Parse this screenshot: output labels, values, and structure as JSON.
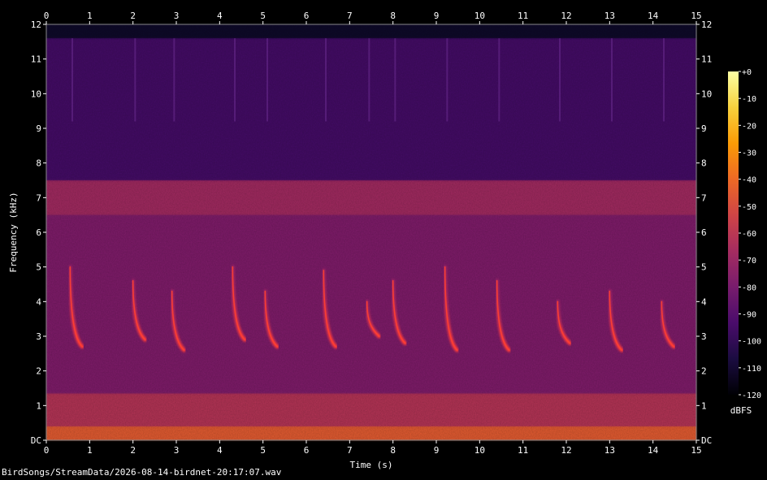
{
  "chart_data": {
    "type": "heatmap",
    "title": "",
    "xlabel": "Time (s)",
    "ylabel": "Frequency (kHz)",
    "xlim": [
      0,
      15
    ],
    "ylim": [
      0,
      12
    ],
    "x_ticks": [
      "0",
      "1",
      "2",
      "3",
      "4",
      "5",
      "6",
      "7",
      "8",
      "9",
      "10",
      "11",
      "12",
      "13",
      "14",
      "15"
    ],
    "y_ticks": [
      "DC",
      "1",
      "2",
      "3",
      "4",
      "5",
      "6",
      "7",
      "8",
      "9",
      "10",
      "11",
      "12"
    ],
    "colorbar": {
      "label": "dBFS",
      "range": [
        -120,
        0
      ],
      "ticks": [
        "+0",
        "-10",
        "-20",
        "-30",
        "-40",
        "-50",
        "-60",
        "-70",
        "-80",
        "-90",
        "-100",
        "-110",
        "-120"
      ],
      "colors": [
        "#000004",
        "#1b0c41",
        "#4a0c6b",
        "#781c6d",
        "#a52c60",
        "#cf4446",
        "#ed6925",
        "#fb9b06",
        "#f7d13d",
        "#fcffa4"
      ]
    },
    "noise_bands": [
      {
        "f_low": 0.0,
        "f_high": 0.4,
        "level_db": -45
      },
      {
        "f_low": 0.4,
        "f_high": 1.35,
        "level_db": -62
      },
      {
        "f_low": 1.35,
        "f_high": 6.5,
        "level_db": -78
      },
      {
        "f_low": 6.5,
        "f_high": 7.5,
        "level_db": -68
      },
      {
        "f_low": 7.5,
        "f_high": 11.6,
        "level_db": -95
      },
      {
        "f_low": 11.6,
        "f_high": 12.0,
        "level_db": -112
      }
    ],
    "calls": [
      {
        "t": 0.55,
        "f_start": 5.0,
        "f_end": 2.7
      },
      {
        "t": 2.0,
        "f_start": 4.6,
        "f_end": 2.9
      },
      {
        "t": 2.9,
        "f_start": 4.3,
        "f_end": 2.6
      },
      {
        "t": 4.3,
        "f_start": 5.0,
        "f_end": 2.9
      },
      {
        "t": 5.05,
        "f_start": 4.3,
        "f_end": 2.7
      },
      {
        "t": 6.4,
        "f_start": 4.9,
        "f_end": 2.7
      },
      {
        "t": 7.4,
        "f_start": 4.0,
        "f_end": 3.0
      },
      {
        "t": 8.0,
        "f_start": 4.6,
        "f_end": 2.8
      },
      {
        "t": 9.2,
        "f_start": 5.0,
        "f_end": 2.6
      },
      {
        "t": 10.4,
        "f_start": 4.6,
        "f_end": 2.6
      },
      {
        "t": 11.8,
        "f_start": 4.0,
        "f_end": 2.8
      },
      {
        "t": 13.0,
        "f_start": 4.3,
        "f_end": 2.6
      },
      {
        "t": 14.2,
        "f_start": 4.0,
        "f_end": 2.7
      }
    ]
  },
  "file": {
    "path": "BirdSongs/StreamData/2026-08-14-birdnet-20:17:07.wav"
  }
}
